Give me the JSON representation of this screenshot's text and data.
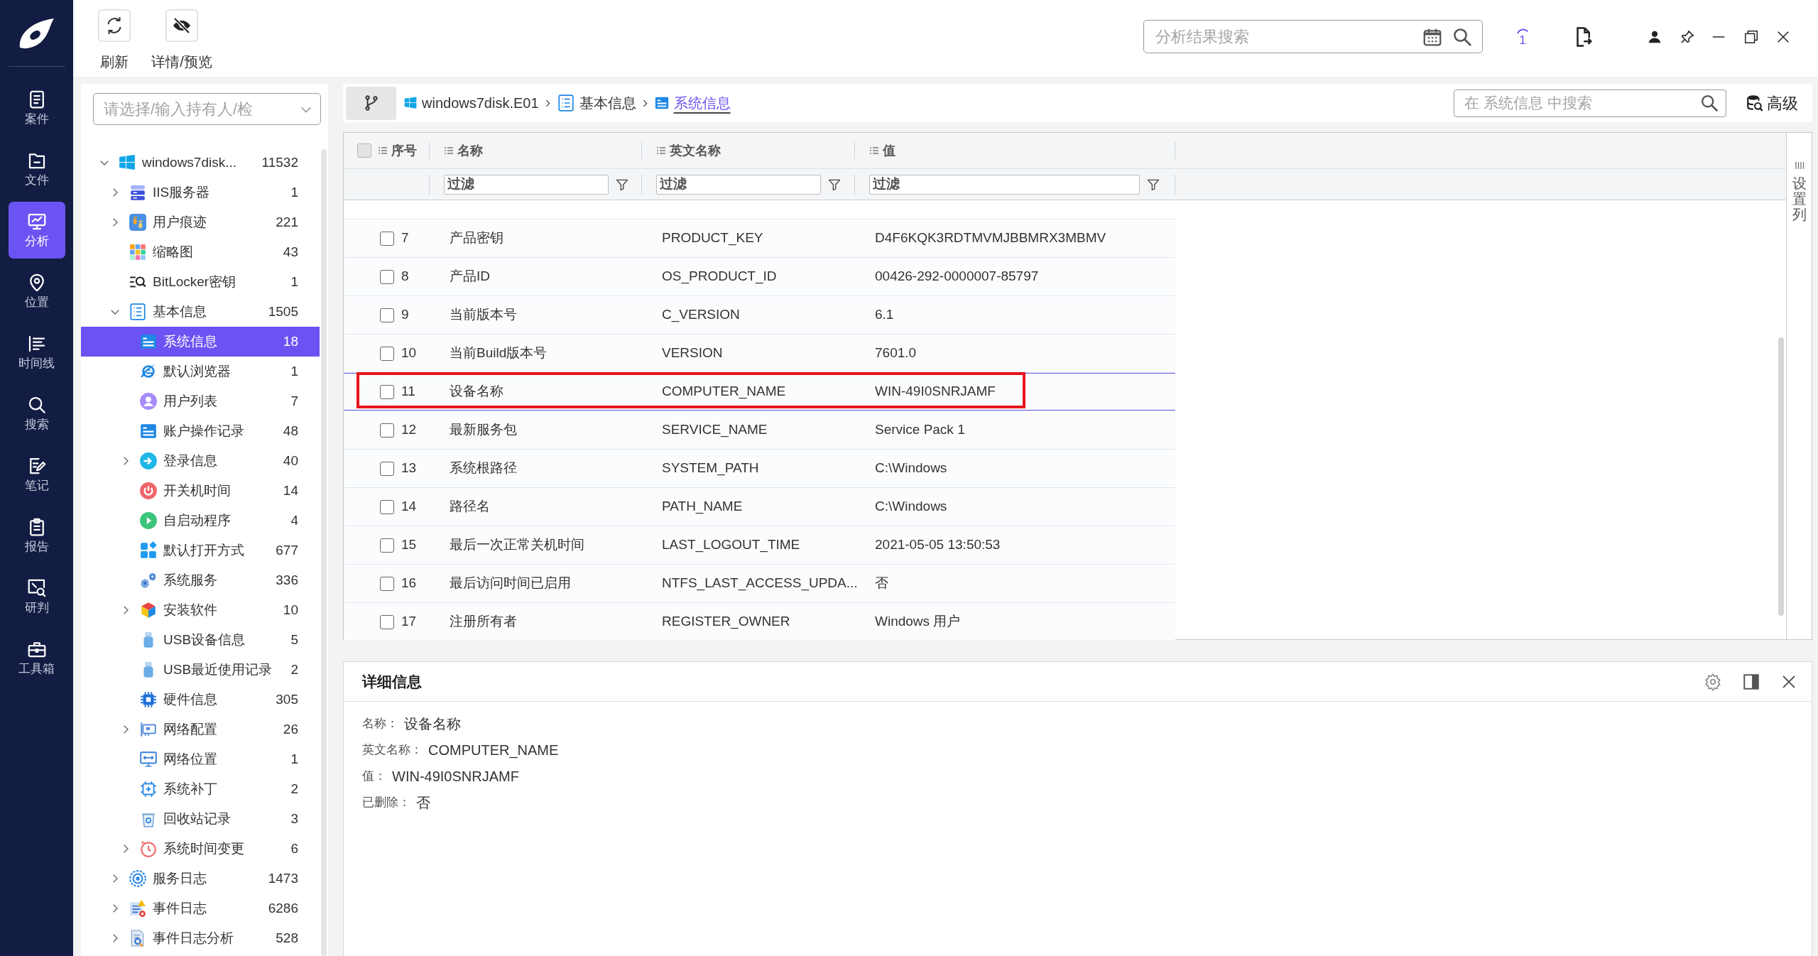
{
  "nav": {
    "items": [
      {
        "label": "案件",
        "kind": "case",
        "selected": false
      },
      {
        "label": "文件",
        "kind": "file",
        "selected": false
      },
      {
        "label": "分析",
        "kind": "analysis",
        "selected": true
      },
      {
        "label": "位置",
        "kind": "location",
        "selected": false
      },
      {
        "label": "时间线",
        "kind": "timeline",
        "selected": false
      },
      {
        "label": "搜索",
        "kind": "search",
        "selected": false
      },
      {
        "label": "笔记",
        "kind": "note",
        "selected": false
      },
      {
        "label": "报告",
        "kind": "report",
        "selected": false
      },
      {
        "label": "研判",
        "kind": "judge",
        "selected": false
      },
      {
        "label": "工具箱",
        "kind": "toolbox",
        "selected": false
      }
    ]
  },
  "toolbar": {
    "buttons": [
      {
        "label": "刷新",
        "kind": "refresh"
      },
      {
        "label": "详情/预览",
        "kind": "preview"
      }
    ]
  },
  "header": {
    "search": {
      "placeholder": "分析结果搜索"
    },
    "task_count": "1"
  },
  "tree": {
    "selector": {
      "placeholder": "请选择/输入持有人/检"
    },
    "items": [
      {
        "label": "windows7disk...",
        "count": "11532",
        "kind": "disk",
        "expanded": true,
        "selected": false,
        "children": [
          {
            "label": "IIS服务器",
            "count": "1",
            "kind": "server",
            "expanded": false,
            "selected": false
          },
          {
            "label": "用户痕迹",
            "count": "221",
            "kind": "trace",
            "expanded": false,
            "selected": false
          },
          {
            "label": "缩略图",
            "count": "43",
            "kind": "thumbnail",
            "selected": false
          },
          {
            "label": "BitLocker密钥",
            "count": "1",
            "kind": "key",
            "selected": false
          },
          {
            "label": "基本信息",
            "count": "1505",
            "kind": "list",
            "expanded": true,
            "selected": false,
            "children": [
              {
                "label": "系统信息",
                "count": "18",
                "kind": "info",
                "selected": true
              },
              {
                "label": "默认浏览器",
                "count": "1",
                "kind": "browser",
                "selected": false
              },
              {
                "label": "用户列表",
                "count": "7",
                "kind": "user",
                "selected": false
              },
              {
                "label": "账户操作记录",
                "count": "48",
                "kind": "record",
                "selected": false
              },
              {
                "label": "登录信息",
                "count": "40",
                "kind": "login",
                "expanded": false,
                "selected": false
              },
              {
                "label": "开关机时间",
                "count": "14",
                "kind": "power",
                "selected": false
              },
              {
                "label": "自启动程序",
                "count": "4",
                "kind": "startup",
                "selected": false
              },
              {
                "label": "默认打开方式",
                "count": "677",
                "kind": "apps",
                "selected": false
              },
              {
                "label": "系统服务",
                "count": "336",
                "kind": "service",
                "selected": false
              },
              {
                "label": "安装软件",
                "count": "10",
                "kind": "software",
                "expanded": false,
                "selected": false
              },
              {
                "label": "USB设备信息",
                "count": "5",
                "kind": "usb",
                "selected": false
              },
              {
                "label": "USB最近使用记录",
                "count": "2",
                "kind": "usb",
                "selected": false
              },
              {
                "label": "硬件信息",
                "count": "305",
                "kind": "hardware",
                "selected": false
              },
              {
                "label": "网络配置",
                "count": "26",
                "kind": "network",
                "expanded": false,
                "selected": false
              },
              {
                "label": "网络位置",
                "count": "1",
                "kind": "location",
                "selected": false
              },
              {
                "label": "系统补丁",
                "count": "2",
                "kind": "patch",
                "selected": false
              },
              {
                "label": "回收站记录",
                "count": "3",
                "kind": "recycle",
                "selected": false
              },
              {
                "label": "系统时间变更",
                "count": "6",
                "kind": "clock",
                "expanded": false,
                "selected": false
              }
            ]
          },
          {
            "label": "服务日志",
            "count": "1473",
            "kind": "log",
            "expanded": false,
            "selected": false
          },
          {
            "label": "事件日志",
            "count": "6286",
            "kind": "event",
            "expanded": false,
            "selected": false
          },
          {
            "label": "事件日志分析",
            "count": "528",
            "kind": "analysis",
            "expanded": false,
            "selected": false
          }
        ]
      }
    ]
  },
  "breadcrumb": [
    {
      "label": "windows7disk.E01",
      "kind": "disk",
      "selected": false
    },
    {
      "label": "基本信息",
      "kind": "list",
      "selected": false
    },
    {
      "label": "系统信息",
      "kind": "info",
      "selected": true
    }
  ],
  "table_search": {
    "placeholder": "在 系统信息 中搜索"
  },
  "advanced_button": "高级",
  "table": {
    "select_all": {
      "checked": false
    },
    "columns": [
      {
        "label": "序号"
      },
      {
        "label": "名称",
        "filter_placeholder": "过滤"
      },
      {
        "label": "英文名称",
        "filter_placeholder": "过滤"
      },
      {
        "label": "值",
        "filter_placeholder": "过滤"
      }
    ],
    "rows": [
      {
        "number": "7",
        "name": "产品密钥",
        "english_name": "PRODUCT_KEY",
        "value": "D4F6KQK3RDTMVMJBBMRX3MBMV",
        "checked": false,
        "selected": false,
        "highlighted": false
      },
      {
        "number": "8",
        "name": "产品ID",
        "english_name": "OS_PRODUCT_ID",
        "value": "00426-292-0000007-85797",
        "checked": false,
        "selected": false,
        "highlighted": false
      },
      {
        "number": "9",
        "name": "当前版本号",
        "english_name": "C_VERSION",
        "value": "6.1",
        "checked": false,
        "selected": false,
        "highlighted": false
      },
      {
        "number": "10",
        "name": "当前Build版本号",
        "english_name": "VERSION",
        "value": "7601.0",
        "checked": false,
        "selected": false,
        "highlighted": false
      },
      {
        "number": "11",
        "name": "设备名称",
        "english_name": "COMPUTER_NAME",
        "value": "WIN-49I0SNRJAMF",
        "checked": false,
        "selected": true,
        "highlighted": true
      },
      {
        "number": "12",
        "name": "最新服务包",
        "english_name": "SERVICE_NAME",
        "value": "Service Pack 1",
        "checked": false,
        "selected": false,
        "highlighted": false
      },
      {
        "number": "13",
        "name": "系统根路径",
        "english_name": "SYSTEM_PATH",
        "value": "C:\\Windows",
        "checked": false,
        "selected": false,
        "highlighted": false
      },
      {
        "number": "14",
        "name": "路径名",
        "english_name": "PATH_NAME",
        "value": "C:\\Windows",
        "checked": false,
        "selected": false,
        "highlighted": false
      },
      {
        "number": "15",
        "name": "最后一次正常关机时间",
        "english_name": "LAST_LOGOUT_TIME",
        "value": "2021-05-05 13:50:53",
        "checked": false,
        "selected": false,
        "highlighted": false
      },
      {
        "number": "16",
        "name": "最后访问时间已启用",
        "english_name": "NTFS_LAST_ACCESS_UPDA...",
        "value": "否",
        "checked": false,
        "selected": false,
        "highlighted": false
      },
      {
        "number": "17",
        "name": "注册所有者",
        "english_name": "REGISTER_OWNER",
        "value": "Windows 用户",
        "checked": false,
        "selected": false,
        "highlighted": false
      }
    ],
    "column_settings": "设置列"
  },
  "details": {
    "title": "详细信息",
    "fields": [
      {
        "label": "名称：",
        "value": "设备名称"
      },
      {
        "label": "英文名称：",
        "value": "COMPUTER_NAME"
      },
      {
        "label": "值：",
        "value": "WIN-49I0SNRJAMF"
      },
      {
        "label": "已删除：",
        "value": "否"
      }
    ]
  }
}
